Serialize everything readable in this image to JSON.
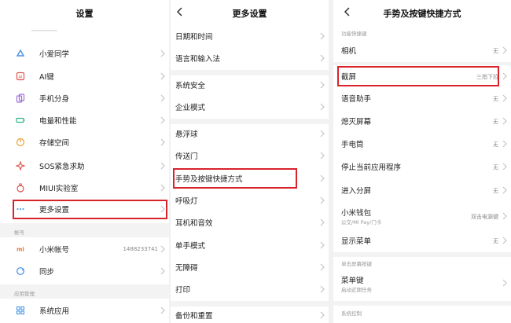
{
  "left_panel": {
    "title": "设置",
    "items": [
      {
        "label": "小爱同学",
        "icon": "xiaoai-icon"
      },
      {
        "label": "AI键",
        "icon": "ai-key-icon"
      },
      {
        "label": "手机分身",
        "icon": "phone-clone-icon"
      },
      {
        "label": "电量和性能",
        "icon": "battery-icon"
      },
      {
        "label": "存储空间",
        "icon": "storage-icon"
      },
      {
        "label": "SOS紧急求助",
        "icon": "sos-icon"
      },
      {
        "label": "MIUI实验室",
        "icon": "lab-icon"
      },
      {
        "label": "更多设置",
        "icon": "more-icon"
      }
    ],
    "account_section": "帐号",
    "mi_account_label": "小米帐号",
    "mi_account_value": "1488233741",
    "sync_label": "同步",
    "apps_section": "应用管理",
    "system_apps_label": "系统应用"
  },
  "middle_panel": {
    "title": "更多设置",
    "items": [
      "日期和时间",
      "语言和输入法",
      "系统安全",
      "企业模式",
      "悬浮球",
      "传送门",
      "手势及按键快捷方式",
      "呼吸灯",
      "耳机和音效",
      "单手模式",
      "无障碍",
      "打印",
      "备份和重置"
    ]
  },
  "right_panel": {
    "title": "手势及按键快捷方式",
    "section_functions": "功能快捷键",
    "items": [
      {
        "label": "相机",
        "value": "无"
      },
      {
        "label": "截屏",
        "value": "三指下拉"
      },
      {
        "label": "语音助手",
        "value": "无"
      },
      {
        "label": "熄灭屏幕",
        "value": "无"
      },
      {
        "label": "手电筒",
        "value": "无"
      },
      {
        "label": "停止当前应用程序",
        "value": "无"
      },
      {
        "label": "进入分屏",
        "value": "无"
      },
      {
        "label": "小米钱包",
        "sub": "公交/Mi Pay/门卡",
        "value": "双击电源键"
      },
      {
        "label": "显示菜单",
        "value": "无"
      }
    ],
    "section_single_press": "单击屏幕按键",
    "menu_key_label": "菜单键",
    "menu_key_sub": "启动近期任务",
    "section_system": "系统控制"
  },
  "colors": {
    "highlight": "#d8232a",
    "chevron": "#c4c4c4",
    "separator": "#f3f3f3",
    "section_text": "#999999"
  }
}
